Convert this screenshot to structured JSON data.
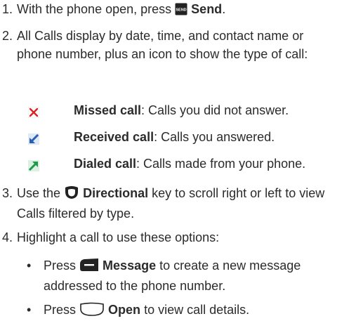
{
  "steps": [
    {
      "num": "1.",
      "pre": "With the phone open, press",
      "key_label": "SEND",
      "bold": "Send",
      "post": "."
    },
    {
      "num": "2.",
      "text": "All Calls display by date, time, and contact name or phone number, plus an icon to show the type of call:"
    },
    {
      "num": "3.",
      "pre": "Use the",
      "bold": "Directional",
      "post": "key to scroll right or left to view Calls filtered by type."
    },
    {
      "num": "4.",
      "text": "Highlight a call to use these options:"
    }
  ],
  "call_types": [
    {
      "icon": "missed-call-icon",
      "label": "Missed call",
      "desc": ": Calls you did not answer."
    },
    {
      "icon": "received-call-icon",
      "label": "Received call",
      "desc": ": Calls you answered."
    },
    {
      "icon": "dialed-call-icon",
      "label": "Dialed call",
      "desc": ": Calls made from your phone."
    }
  ],
  "options": [
    {
      "bullet": "•",
      "pre": "Press",
      "bold": "Message",
      "post": "to create a new message addressed to the phone number."
    },
    {
      "bullet": "•",
      "pre": "Press",
      "bold": "Open",
      "post": "to view call details."
    }
  ],
  "colors": {
    "text": "#2b2b2b",
    "missed": "#e02020",
    "received": "#2a5fb0",
    "dialed": "#1f9a4a",
    "key": "#222222"
  }
}
